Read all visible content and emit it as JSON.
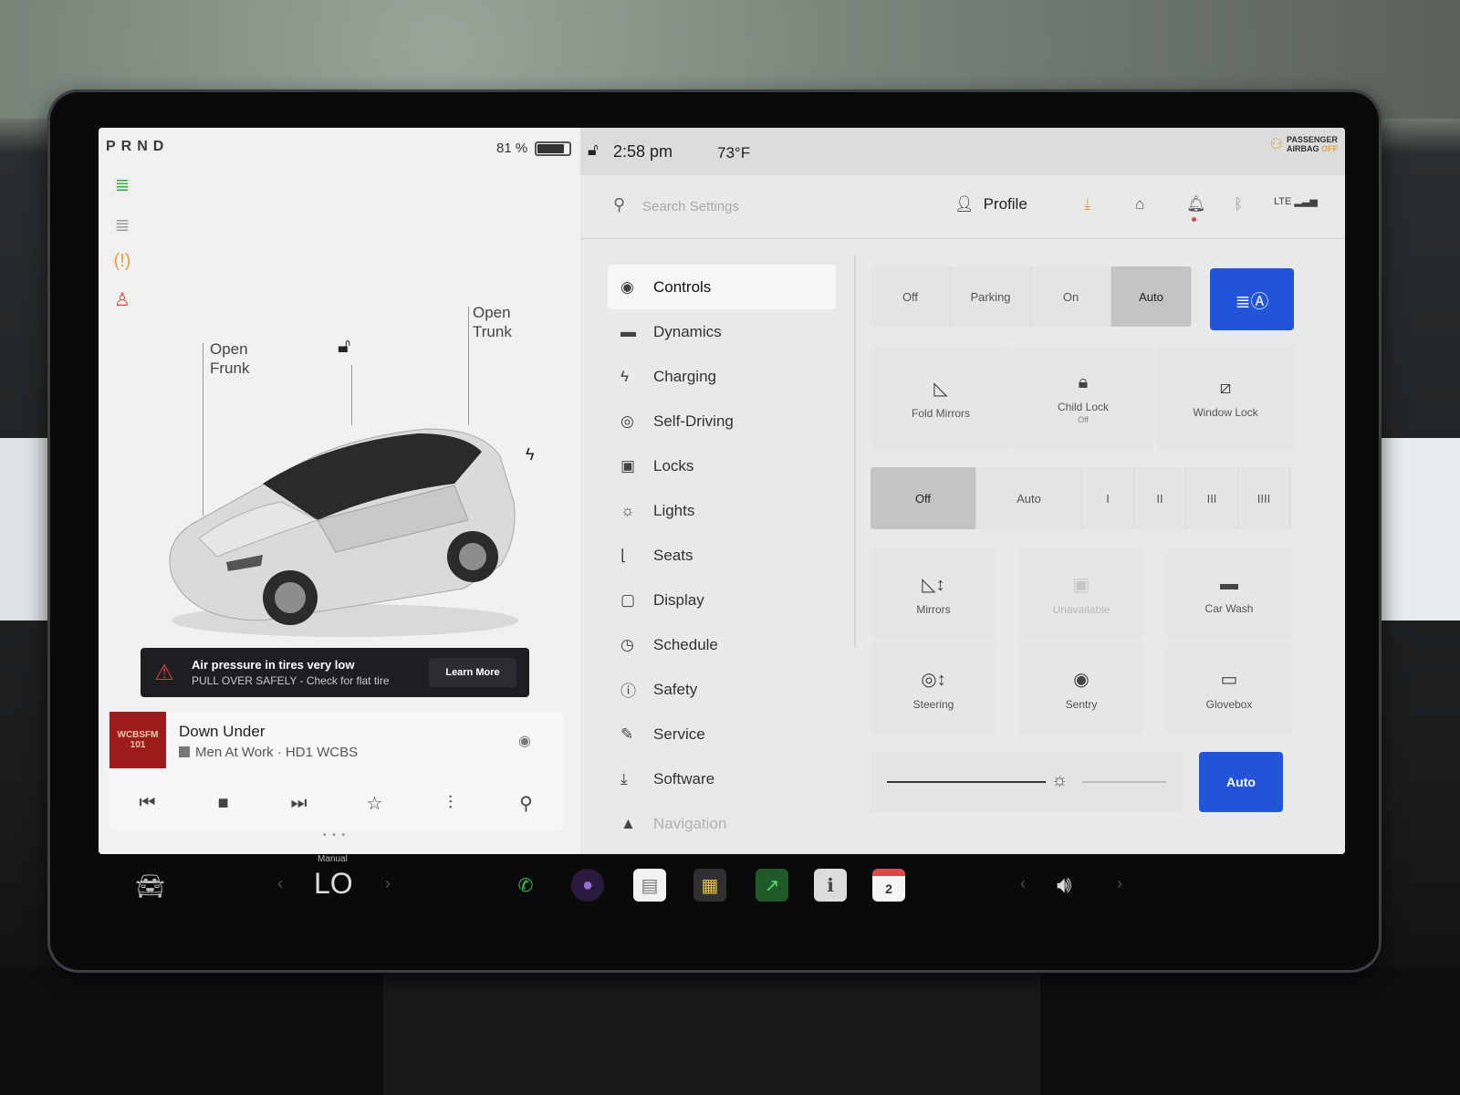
{
  "gear": "PRND",
  "battery": {
    "percent_text": "81 %",
    "level": 0.81
  },
  "car_panel": {
    "frunk_label": "Open\nFrunk",
    "frunk_line1": "Open",
    "frunk_line2": "Frunk",
    "trunk_line1": "Open",
    "trunk_line2": "Trunk"
  },
  "alert": {
    "title": "Air pressure in tires very low",
    "subtitle": "PULL OVER SAFELY - Check for flat tire",
    "button": "Learn More"
  },
  "media": {
    "album_text": "WCBSFM 101",
    "song": "Down Under",
    "artist": "Men At Work · HD1 WCBS"
  },
  "status": {
    "time": "2:58 pm",
    "temperature": "73°F",
    "airbag_line1": "PASSENGER",
    "airbag_line2": "AIRBAG",
    "airbag_state": "OFF"
  },
  "search": {
    "placeholder": "Search Settings"
  },
  "profile_label": "Profile",
  "lte": "LTE",
  "menu": [
    {
      "label": "Controls",
      "icon": "toggle-icon",
      "glyph": "◉"
    },
    {
      "label": "Dynamics",
      "icon": "car-icon",
      "glyph": "▬"
    },
    {
      "label": "Charging",
      "icon": "bolt-icon",
      "glyph": "ϟ"
    },
    {
      "label": "Self-Driving",
      "icon": "steering-wheel-icon",
      "glyph": "◎"
    },
    {
      "label": "Locks",
      "icon": "lock-icon",
      "glyph": "▣"
    },
    {
      "label": "Lights",
      "icon": "sun-icon",
      "glyph": "☼"
    },
    {
      "label": "Seats",
      "icon": "seat-icon",
      "glyph": "⌊"
    },
    {
      "label": "Display",
      "icon": "display-icon",
      "glyph": "▢"
    },
    {
      "label": "Schedule",
      "icon": "clock-icon",
      "glyph": "◷"
    },
    {
      "label": "Safety",
      "icon": "safety-icon",
      "glyph": "ⓘ"
    },
    {
      "label": "Service",
      "icon": "wrench-icon",
      "glyph": "✎"
    },
    {
      "label": "Software",
      "icon": "download-icon",
      "glyph": "⤓"
    },
    {
      "label": "Navigation",
      "icon": "navigation-icon",
      "glyph": "▲"
    }
  ],
  "lights": {
    "options": [
      "Off",
      "Parking",
      "On",
      "Auto"
    ],
    "selected": "Auto"
  },
  "row1": [
    {
      "label": "Fold Mirrors",
      "sub": ""
    },
    {
      "label": "Child Lock",
      "sub": "Off"
    },
    {
      "label": "Window Lock",
      "sub": ""
    }
  ],
  "wipers": {
    "options": [
      "Off",
      "Auto",
      "I",
      "II",
      "III",
      "IIII"
    ],
    "selected": "Off"
  },
  "row2": [
    {
      "label": "Mirrors"
    },
    {
      "label": "Unavailable"
    },
    {
      "label": "Car Wash"
    }
  ],
  "row3": [
    {
      "label": "Steering"
    },
    {
      "label": "Sentry"
    },
    {
      "label": "Glovebox"
    }
  ],
  "brightness": {
    "level": 0.6,
    "auto_label": "Auto"
  },
  "taskbar": {
    "climate_mode": "Manual",
    "climate_value": "LO",
    "calendar_day": "2"
  },
  "colors": {
    "accent_blue": "#2254d9",
    "alert_red": "#e23b3b",
    "indicator_green": "#2fae3a"
  }
}
